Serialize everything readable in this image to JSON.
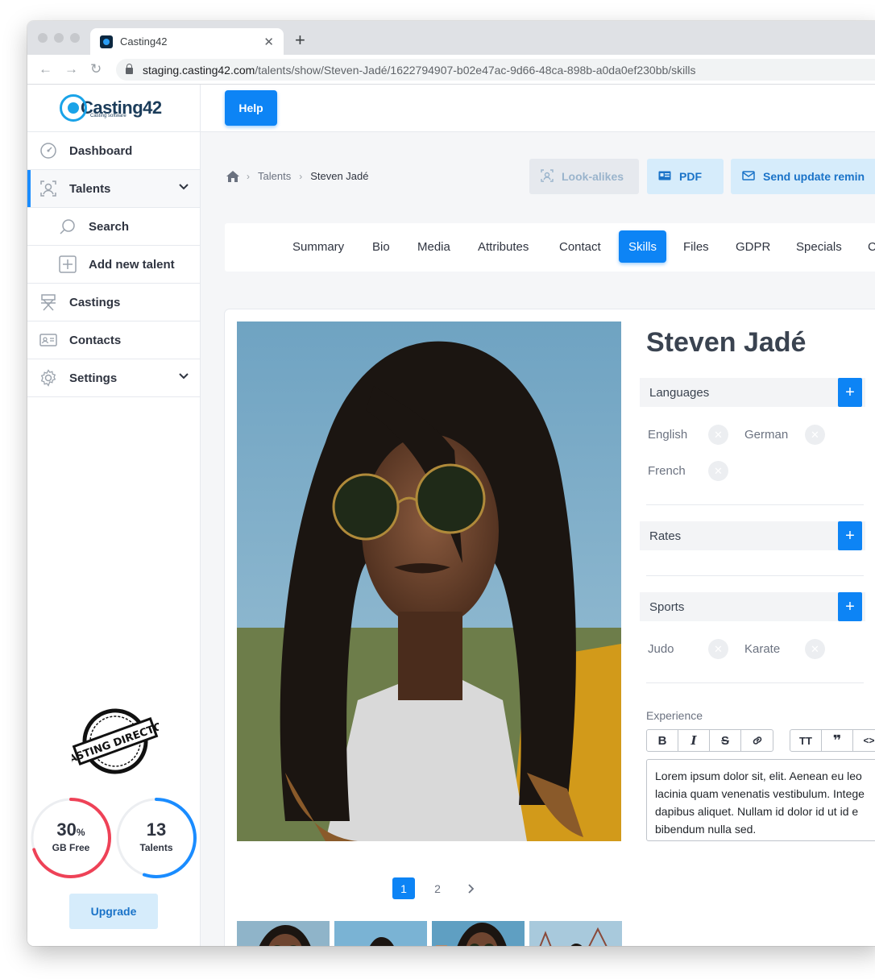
{
  "browser": {
    "tab_title": "Casting42",
    "url_host": "staging.casting42.com",
    "url_path": "/talents/show/Steven-Jadé/1622794907-b02e47ac-9d66-48ca-898b-a0da0ef230bb/skills"
  },
  "sidebar": {
    "logo_text": "Casting42",
    "logo_sub": "Casting software",
    "items": [
      {
        "label": "Dashboard",
        "icon": "dashboard-icon"
      },
      {
        "label": "Talents",
        "icon": "talents-icon",
        "active": true
      },
      {
        "label": "Search",
        "icon": "search-icon"
      },
      {
        "label": "Add new talent",
        "icon": "add-icon"
      },
      {
        "label": "Castings",
        "icon": "director-chair-icon"
      },
      {
        "label": "Contacts",
        "icon": "contacts-icon"
      },
      {
        "label": "Settings",
        "icon": "gear-icon"
      }
    ],
    "stamp_text": "CASTING DIRECTOR",
    "storage": {
      "value": "30",
      "unit": "%",
      "label": "GB Free",
      "fraction_used": 0.7,
      "color": "#ee4257"
    },
    "talents": {
      "value": "13",
      "label": "Talents",
      "fraction": 0.55,
      "color": "#1a8cff"
    },
    "upgrade_label": "Upgrade"
  },
  "topbar": {
    "help_label": "Help"
  },
  "breadcrumb": {
    "items": [
      "Talents",
      "Steven Jadé"
    ]
  },
  "actions": {
    "lookalikes": "Look-alikes",
    "pdf": "PDF",
    "send": "Send update remin"
  },
  "tabs": [
    "Summary",
    "Bio",
    "Media",
    "Attributes",
    "Contact",
    "Skills",
    "Files",
    "GDPR",
    "Specials",
    "C"
  ],
  "active_tab": "Skills",
  "talent": {
    "name": "Steven Jadé",
    "pagination": [
      "1",
      "2"
    ],
    "languages": {
      "title": "Languages",
      "items": [
        "English",
        "German",
        "French"
      ]
    },
    "rates": {
      "title": "Rates"
    },
    "sports": {
      "title": "Sports",
      "items": [
        "Judo",
        "Karate"
      ]
    },
    "experience": {
      "label": "Experience",
      "text_lines": [
        "Lorem ipsum dolor sit,  elit. Aenean eu leo",
        "lacinia quam venenatis vestibulum. Intege",
        "dapibus  aliquet. Nullam id dolor id  ut id e",
        "bibendum nulla sed."
      ]
    }
  },
  "colors": {
    "accent": "#0d84f5",
    "light_accent": "#d6ecfb"
  }
}
